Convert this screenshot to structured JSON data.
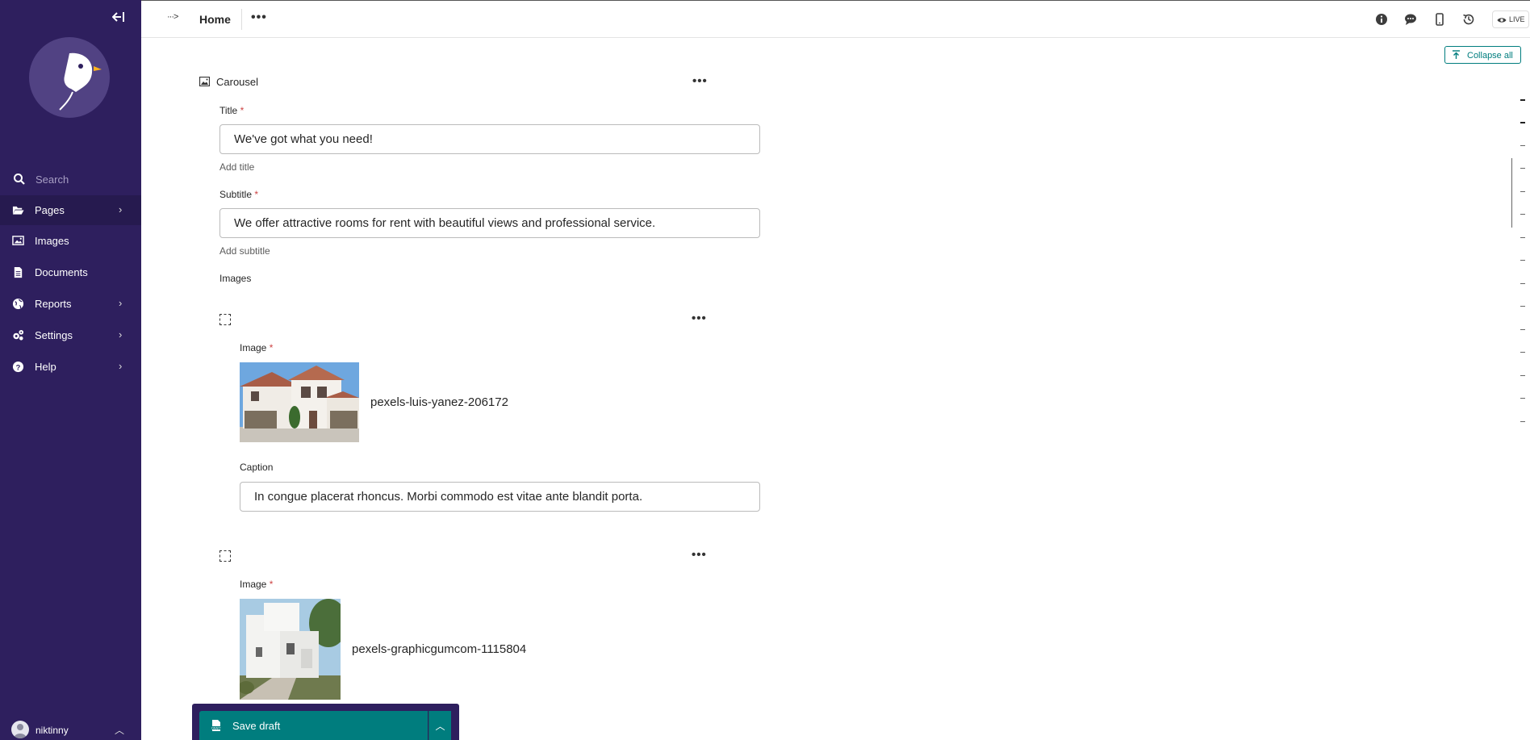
{
  "sidebar": {
    "search_placeholder": "Search",
    "items": [
      {
        "label": "Pages",
        "has_children": true
      },
      {
        "label": "Images",
        "has_children": false
      },
      {
        "label": "Documents",
        "has_children": false
      },
      {
        "label": "Reports",
        "has_children": true
      },
      {
        "label": "Settings",
        "has_children": true
      },
      {
        "label": "Help",
        "has_children": true
      }
    ],
    "account": {
      "username": "niktinny"
    }
  },
  "header": {
    "breadcrumb_toggle": "···>",
    "page_title": "Home",
    "live_label": "LIVE",
    "actions": [
      "info-icon",
      "comment-icon",
      "mobile-preview-icon",
      "history-icon",
      "eye-icon"
    ]
  },
  "toolbar": {
    "collapse_all_label": "Collapse all"
  },
  "carousel": {
    "block_label": "Carousel",
    "title": {
      "label": "Title",
      "required_mark": "*",
      "value": "We've got what you need!",
      "help": "Add title"
    },
    "subtitle": {
      "label": "Subtitle",
      "required_mark": "*",
      "value": "We offer attractive rooms for rent with beautiful views and professional service.",
      "help": "Add subtitle"
    },
    "images_label": "Images",
    "images": [
      {
        "image_label": "Image",
        "required_mark": "*",
        "file_name": "pexels-luis-yanez-206172",
        "caption_label": "Caption",
        "caption": "In congue placerat rhoncus. Morbi commodo est vitae ante blandit porta."
      },
      {
        "image_label": "Image",
        "required_mark": "*",
        "file_name": "pexels-graphicgumcom-1115804"
      }
    ]
  },
  "footer": {
    "save_label": "Save draft"
  },
  "colors": {
    "sidebar": "#2e1f5e",
    "accent": "#007d7e",
    "required": "#cd4444"
  }
}
